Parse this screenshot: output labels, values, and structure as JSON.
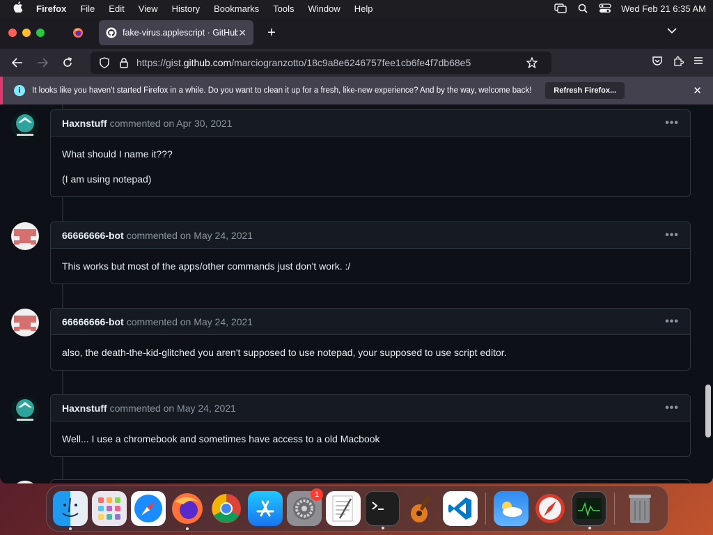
{
  "menubar": {
    "app": "Firefox",
    "items": [
      "File",
      "Edit",
      "View",
      "History",
      "Bookmarks",
      "Tools",
      "Window",
      "Help"
    ],
    "clock": "Wed Feb 21  6:35 AM"
  },
  "browser": {
    "tab_title": "fake-virus.applescript · GitHub",
    "url_prefix": "https://gist.",
    "url_host": "github.com",
    "url_path": "/marciogranzotto/18c9a8e6246757fee1cb6fe4f7db68e5",
    "notice": {
      "message": "It looks like you haven't started Firefox in a while. Do you want to clean it up for a fresh, like-new experience? And by the way, welcome back!",
      "button": "Refresh Firefox..."
    }
  },
  "comments": [
    {
      "author": "Haxnstuff",
      "meta": "commented on Apr 30, 2021",
      "body": [
        "What should I name it???",
        "(I am using notepad)"
      ],
      "avatar": "haxnstuff"
    },
    {
      "author": "66666666-bot",
      "meta": "commented on May 24, 2021",
      "body": [
        "This works but most of the apps/other commands just don't work. :/"
      ],
      "avatar": "bot"
    },
    {
      "author": "66666666-bot",
      "meta": "commented on May 24, 2021",
      "body": [
        "also, the death-the-kid-glitched you aren't supposed to use notepad, your supposed to use script editor."
      ],
      "avatar": "bot"
    },
    {
      "author": "Haxnstuff",
      "meta": "commented on May 24, 2021",
      "body": [
        "Well... I use a chromebook and sometimes have access to a old Macbook"
      ],
      "avatar": "haxnstuff"
    }
  ],
  "dock": {
    "apps": [
      "finder-icon",
      "launchpad-icon",
      "safari-icon",
      "firefox-icon",
      "chrome-icon",
      "app-store-icon",
      "system-settings-icon",
      "textedit-icon",
      "terminal-icon",
      "garageband-icon",
      "vscode-icon",
      "weather-icon",
      "safari-dev-icon",
      "activity-monitor-icon",
      "trash-icon"
    ],
    "settings_badge": "1"
  }
}
